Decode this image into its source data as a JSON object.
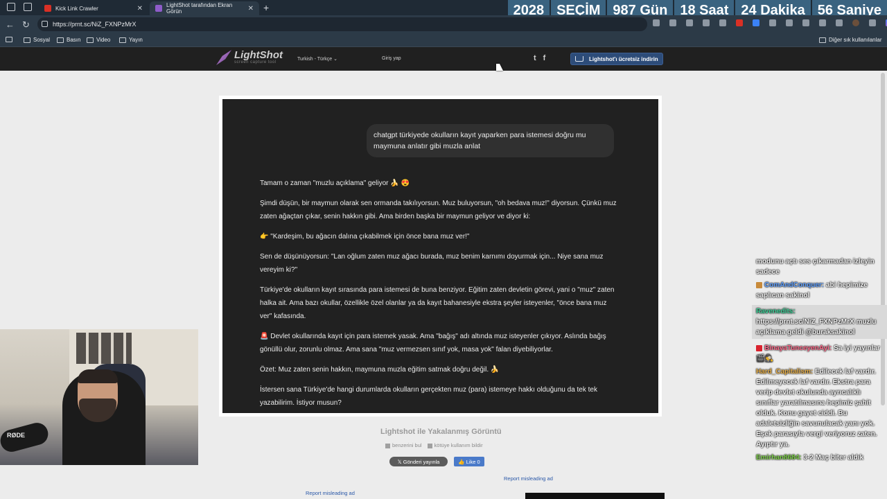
{
  "browser": {
    "tabs": [
      {
        "label": "Kick Link Crawler",
        "active": false,
        "favicon_color": "#d93025"
      },
      {
        "label": "LightShot tarafından Ekran Görün",
        "active": true,
        "favicon_color": "#8e5cc9"
      }
    ],
    "new_tab_label": "+",
    "url": "https://prnt.sc/NiZ_FXNPzMrX",
    "bookmarks": [
      "Sosyal",
      "Basın",
      "Video",
      "Yayın"
    ],
    "other_bookmarks": "Diğer sık kullanılanlar"
  },
  "countdown": {
    "segments": [
      "2028",
      "SEÇİM",
      "987 Gün",
      "18 Saat",
      "24 Dakika",
      "56 Saniye"
    ]
  },
  "lightshot": {
    "logo_title": "LightShot",
    "logo_subtitle": "screen capture tool",
    "language": "Turkish - Türkçe",
    "login": "Giriş yap",
    "twitter_icon": "t",
    "facebook_icon": "f",
    "download_button": "Lightshot'ı ücretsiz indirin",
    "caption": "Lightshot ile Yakalanmış Görüntü",
    "similar_link": "benzerini bul",
    "report_abuse_link": "kötüye kullanım bildir",
    "tweet_button": "Gönderi yayınla",
    "like_button": "Like 0",
    "report_ad_1": "Report misleading ad",
    "report_ad_2": "Report misleading ad"
  },
  "screenshot": {
    "user_prompt": "chatgpt türkiyede okulların kayıt yaparken para istemesi doğru mu maymuna anlatır gibi muzla anlat",
    "reply_paragraphs": [
      "Tamam o zaman \"muzlu açıklama\" geliyor 🍌 😍",
      "Şimdi düşün, bir maymun olarak sen ormanda takılıyorsun. Muz buluyorsun, \"oh bedava muz!\" diyorsun. Çünkü muz zaten ağaçtan çıkar, senin hakkın gibi. Ama birden başka bir maymun geliyor ve diyor ki:",
      "👉 \"Kardeşim, bu ağacın dalına çıkabilmek için önce bana muz ver!\"",
      "Sen de düşünüyorsun: \"Lan oğlum zaten muz ağacı burada, muz benim karnımı doyurmak için... Niye sana muz vereyim ki?\"",
      "Türkiye'de okulların kayıt sırasında para istemesi de buna benziyor. Eğitim zaten devletin görevi, yani o \"muz\" zaten halka ait. Ama bazı okullar, özellikle özel olanlar ya da kayıt bahanesiyle ekstra şeyler isteyenler, \"önce bana muz ver\" kafasında.",
      "🚨 Devlet okullarında kayıt için para istemek yasak. Ama \"bağış\" adı altında muz isteyenler çıkıyor. Aslında bağış gönüllü olur, zorunlu olmaz. Ama sana \"muz vermezsen sınıf yok, masa yok\" falan diyebiliyorlar.",
      "Özet: Muz zaten senin hakkın, maymuna muzla eğitim satmak doğru değil. 🍌",
      "İstersen sana Türkiye'de hangi durumlarda okulların gerçekten muz (para) istemeye hakkı olduğunu da tek tek yazabilirim. İstiyor musun?"
    ]
  },
  "webcam": {
    "mic_brand": "RØDE"
  },
  "chat": [
    {
      "user": "",
      "text": "modunu açtı ses çıkarmadan izleyin sadece",
      "color": "#f2f2f2",
      "highlight": false
    },
    {
      "user": "ComAndConquer:",
      "text": " abi hepimize saplıcan sakinol",
      "color": "#5fa0ff",
      "highlight": false
    },
    {
      "user": "Ravenedits:",
      "text": " https://prnt.sc/NiZ_FXNPzMrX muzlu açıklama geldi @buraksakinol",
      "color": "#3fd29a",
      "highlight": true
    },
    {
      "user": "BinayaTunceyenAyi:",
      "text": " Sa iyi yayınlar 🎬🕵",
      "color": "#ff6a8a",
      "highlight": false
    },
    {
      "user": "Hard_Capitalism:",
      "text": " Edilecek laf vardır. Edilmeyecek laf vardır. Ekstra para verip devlet okulunda ayrıcalıklı sınıflar yaratılmasına hepimiz şahit olduk. Konu gayet ciddi. Bu adaletsizliğin savunulacak yanı yok. Eşek parasıyla vergi veriyoruz zaten. Ayıptır ya.",
      "color": "#e8b04a",
      "highlight": false
    },
    {
      "user": "Emirhan8684:",
      "text": " 3-2 Maç biter aldık",
      "color": "#7fd34a",
      "highlight": false
    }
  ]
}
